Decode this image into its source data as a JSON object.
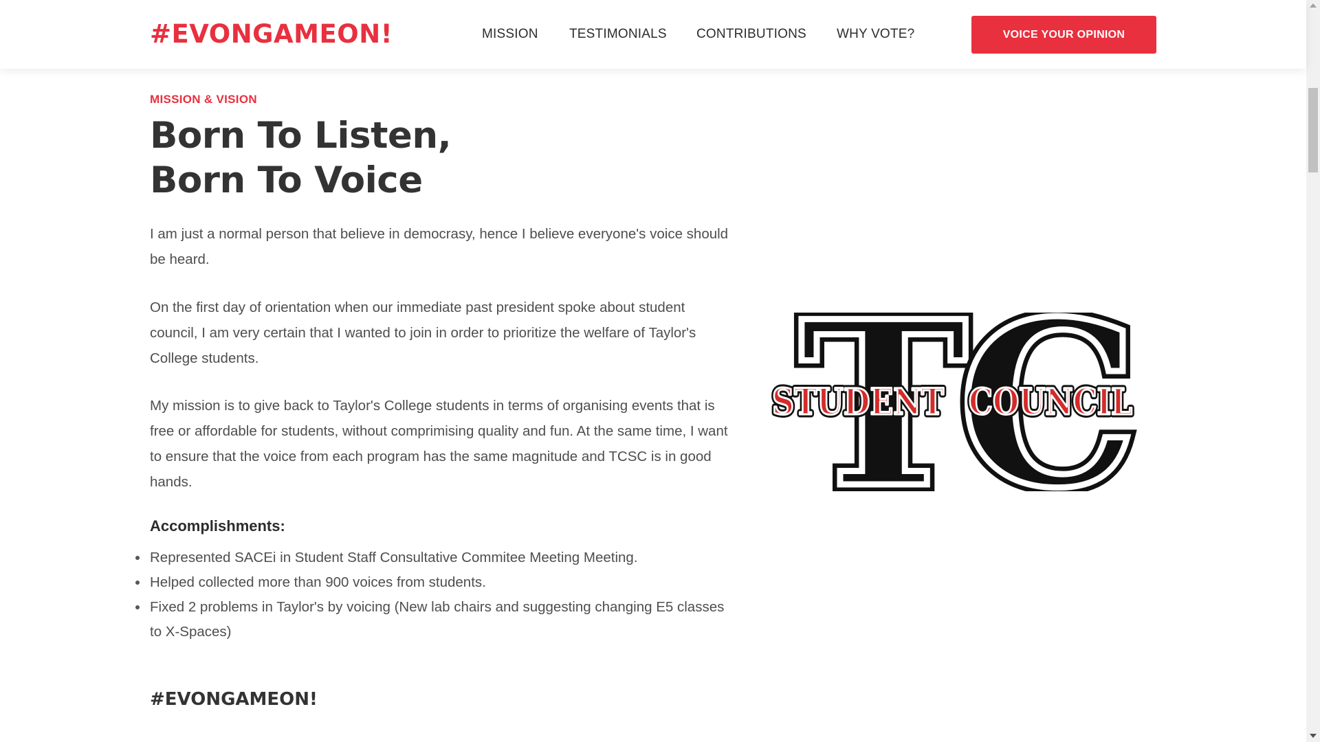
{
  "nav": {
    "logo": "#EVONGAMEON!",
    "links": [
      "MISSION",
      "TESTIMONIALS",
      "CONTRIBUTIONS",
      "WHY VOTE?"
    ],
    "cta": "VOICE YOUR OPINION"
  },
  "section": {
    "eyebrow": "MISSION & VISION",
    "headline": [
      "Born To Listen,",
      "Born To Voice"
    ],
    "paragraphs": [
      "I am just a normal person that believe in democrasy, hence I believe everyone's voice should be heard.",
      "On the first day of orientation when our immediate past president spoke about student council, I am very certain that I wanted to join in order to prioritize the welfare of Taylor's College students.",
      "My mission is to give back to Taylor's College students in terms of organising events that is free or affordable for students, without comprimising quality and fun. At the same time, I want to ensure that the voice from each program has the same magnitude and TCSC is in good hands."
    ],
    "accomplishments_title": "Accomplishments:",
    "accomplishments": [
      "Represented SACEi in Student Staff Consultative Commitee Meeting Meeting.",
      "Helped collected more than 900 voices from students.",
      "Fixed 2 problems in Taylor's by voicing (New lab chairs and suggesting changing E5 classes to X-Spaces)"
    ],
    "footer_tag": "#EVONGAMEON!"
  },
  "logo_image": {
    "letters": [
      "T",
      "C"
    ],
    "banner_left": "STUDENT",
    "banner_right": "COUNCIL"
  },
  "colors": {
    "accent": "#e8303f",
    "heading": "#333333",
    "body_text": "#4e4e4e",
    "logo_black": "#111111",
    "logo_red": "#d42b2b"
  }
}
